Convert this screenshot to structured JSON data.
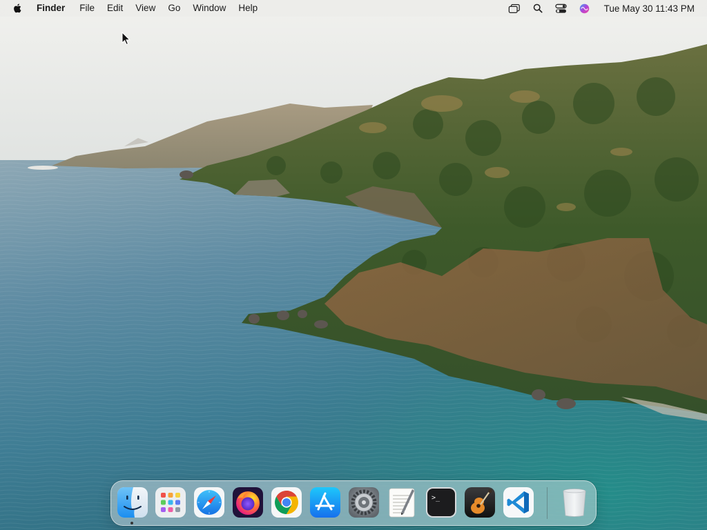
{
  "menubar": {
    "app_name": "Finder",
    "menus": [
      "File",
      "Edit",
      "View",
      "Go",
      "Window",
      "Help"
    ],
    "clock": "Tue May 30  11:43 PM",
    "status_icons": [
      "window-stack-icon",
      "search-icon",
      "control-center-icon",
      "siri-icon"
    ]
  },
  "dock": {
    "apps": [
      {
        "icon": "finder-icon",
        "running": true
      },
      {
        "icon": "launchpad-icon",
        "running": false
      },
      {
        "icon": "safari-icon",
        "running": false
      },
      {
        "icon": "firefox-icon",
        "running": false
      },
      {
        "icon": "chrome-icon",
        "running": false
      },
      {
        "icon": "app-store-icon",
        "running": false
      },
      {
        "icon": "system-preferences-icon",
        "running": false
      },
      {
        "icon": "textedit-icon",
        "running": false
      },
      {
        "icon": "terminal-icon",
        "running": false
      },
      {
        "icon": "garageband-icon",
        "running": false
      },
      {
        "icon": "vscode-icon",
        "running": false
      },
      {
        "icon": "trash-icon",
        "running": false
      }
    ]
  },
  "colors": {
    "menubar_bg": "#ECECE9",
    "sea_deep": "#4a7f99",
    "sea_shallow": "#2f8f8a",
    "hill_green": "#3f5e2a",
    "sky": "#e8e9e6"
  }
}
